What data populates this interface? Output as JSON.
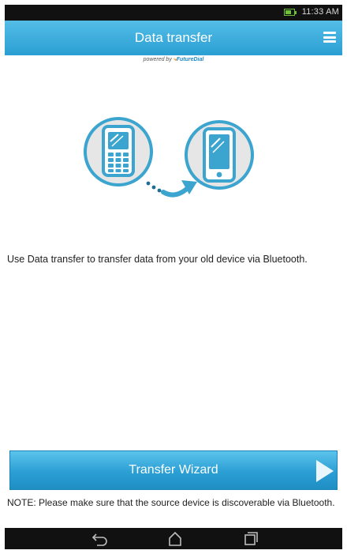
{
  "status_bar": {
    "time": "11:33 AM",
    "battery_level": 0.7
  },
  "app_bar": {
    "title": "Data transfer",
    "menu_icon": "menu-icon"
  },
  "powered_by": {
    "prefix": "powered by",
    "brand": "FutureDial"
  },
  "illustration": {
    "icons": [
      "feature-phone-icon",
      "transfer-arrow-icon",
      "smartphone-icon"
    ],
    "accent": "#3ba4cf",
    "circle_fill": "#e6e6e6"
  },
  "description": "Use Data transfer to transfer data from your old device via Bluetooth.",
  "wizard_button": {
    "label": "Transfer Wizard",
    "icon": "play-arrow-icon"
  },
  "note": "NOTE: Please make sure that the source device is discoverable via Bluetooth.",
  "nav_bar": {
    "icons": [
      "back-icon",
      "home-icon",
      "recent-apps-icon"
    ]
  },
  "colors": {
    "app_bar": "#2a9fd3",
    "button": "#2b9fd4",
    "system_bar": "#111111",
    "battery": "#6fbf3a"
  }
}
